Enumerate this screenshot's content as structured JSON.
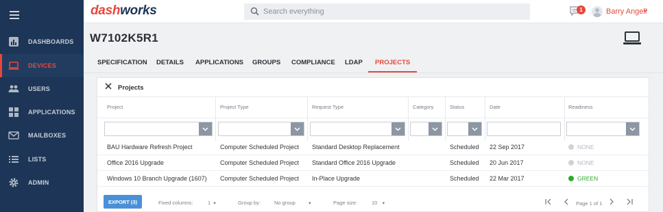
{
  "brand": {
    "part1": "dash",
    "part2": "works"
  },
  "search": {
    "placeholder": "Search everything"
  },
  "notifications": {
    "count": "1"
  },
  "user": {
    "name": "Barry Angell"
  },
  "sidebar": {
    "items": [
      {
        "label": "DASHBOARDS",
        "icon": "bar-chart-icon"
      },
      {
        "label": "DEVICES",
        "icon": "laptop-icon",
        "active": true
      },
      {
        "label": "USERS",
        "icon": "users-icon"
      },
      {
        "label": "APPLICATIONS",
        "icon": "apps-icon"
      },
      {
        "label": "MAILBOXES",
        "icon": "envelope-icon"
      },
      {
        "label": "LISTS",
        "icon": "list-icon"
      },
      {
        "label": "ADMIN",
        "icon": "gear-icon"
      }
    ]
  },
  "page": {
    "title": "W7102K5R1"
  },
  "tabs": [
    "SPECIFICATION",
    "DETAILS",
    "APPLICATIONS",
    "GROUPS",
    "COMPLIANCE",
    "LDAP",
    "PROJECTS"
  ],
  "active_tab": "PROJECTS",
  "panel": {
    "title": "Projects",
    "columns": [
      "Project",
      "Project Type",
      "Request Type",
      "Category",
      "Status",
      "Date",
      "Readiness"
    ],
    "rows": [
      {
        "project": "BAU Hardware Refresh Project",
        "project_type": "Computer Scheduled Project",
        "request_type": "Standard Desktop Replacement",
        "category": "",
        "status": "Scheduled",
        "date": "22 Sep 2017",
        "readiness": "NONE",
        "readiness_color": "#cfd3d8"
      },
      {
        "project": "Office 2016 Upgrade",
        "project_type": "Computer Scheduled Project",
        "request_type": "Standard Office 2016 Upgrade",
        "category": "",
        "status": "Scheduled",
        "date": "20 Jun 2017",
        "readiness": "NONE",
        "readiness_color": "#cfd3d8"
      },
      {
        "project": "Windows 10 Branch Upgrade (1607)",
        "project_type": "Computer Scheduled Project",
        "request_type": "In-Place Upgrade",
        "category": "",
        "status": "Scheduled",
        "date": "22 Mar 2017",
        "readiness": "GREEN",
        "readiness_color": "#2eaa2e"
      }
    ]
  },
  "footer": {
    "export_label": "EXPORT (3)",
    "fixed_columns_label": "Fixed columns:",
    "fixed_columns_value": "1",
    "group_by_label": "Group by:",
    "group_by_value": "No group",
    "page_size_label": "Page size:",
    "page_size_value": "10",
    "pagination": "Page 1 of 1"
  },
  "colors": {
    "accent": "#e5483d",
    "sidebar": "#1d3556",
    "button": "#4a90d9",
    "ready_green": "#2eaa2e"
  }
}
